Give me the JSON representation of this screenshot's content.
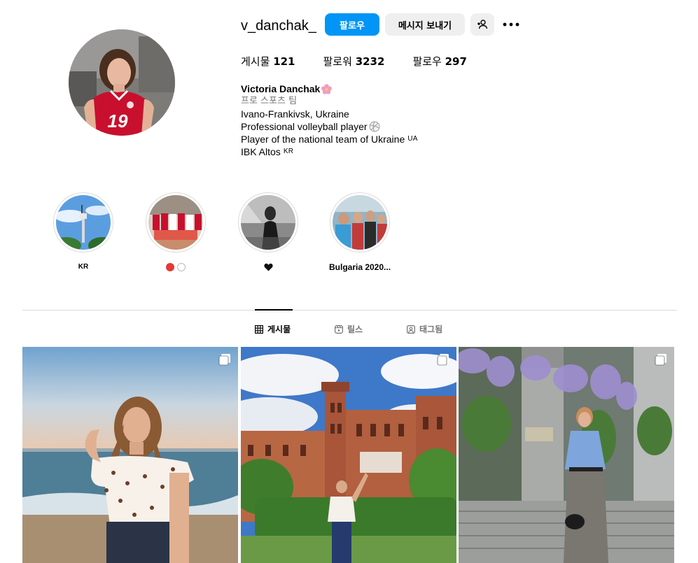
{
  "profile": {
    "username": "v_danchak_",
    "follow_label": "팔로우",
    "message_label": "메시지 보내기",
    "stats": [
      {
        "label": "게시물",
        "value": "121"
      },
      {
        "label": "팔로워",
        "value": "3232"
      },
      {
        "label": "팔로우",
        "value": "297"
      }
    ],
    "bio": {
      "name": "Victoria Danchak",
      "category": "프로 스포츠 팀",
      "lines": [
        {
          "text": "Ivano-Frankivsk, Ukraine",
          "suffix": ""
        },
        {
          "text": "Professional volleyball player",
          "suffix": ""
        },
        {
          "text": "Player of the national team of Ukraine",
          "suffix": "UA"
        },
        {
          "text": "IBK Altos",
          "suffix": "KR"
        }
      ]
    },
    "avatar_jersey_number": "19"
  },
  "highlights": [
    {
      "label": "KR",
      "icon": "landmark-tower"
    },
    {
      "label": "",
      "icon": "red-white-dots"
    },
    {
      "label": "",
      "icon": "black-heart"
    },
    {
      "label": "Bulgaria 2020...",
      "icon": "team-photo"
    }
  ],
  "tabs": [
    {
      "label": "게시물",
      "icon": "grid-icon",
      "active": true
    },
    {
      "label": "릴스",
      "icon": "reels-icon",
      "active": false
    },
    {
      "label": "태그됨",
      "icon": "tag-icon",
      "active": false
    }
  ],
  "posts": [
    {
      "alt_topic": "beach",
      "multi": true
    },
    {
      "alt_topic": "castle",
      "multi": true
    },
    {
      "alt_topic": "building",
      "multi": true
    }
  ],
  "colors": {
    "accent": "#0095f6",
    "button_gray": "#efefef",
    "muted_text": "#737373",
    "divider": "#dbdbdb",
    "jersey_red": "#c8102e"
  }
}
